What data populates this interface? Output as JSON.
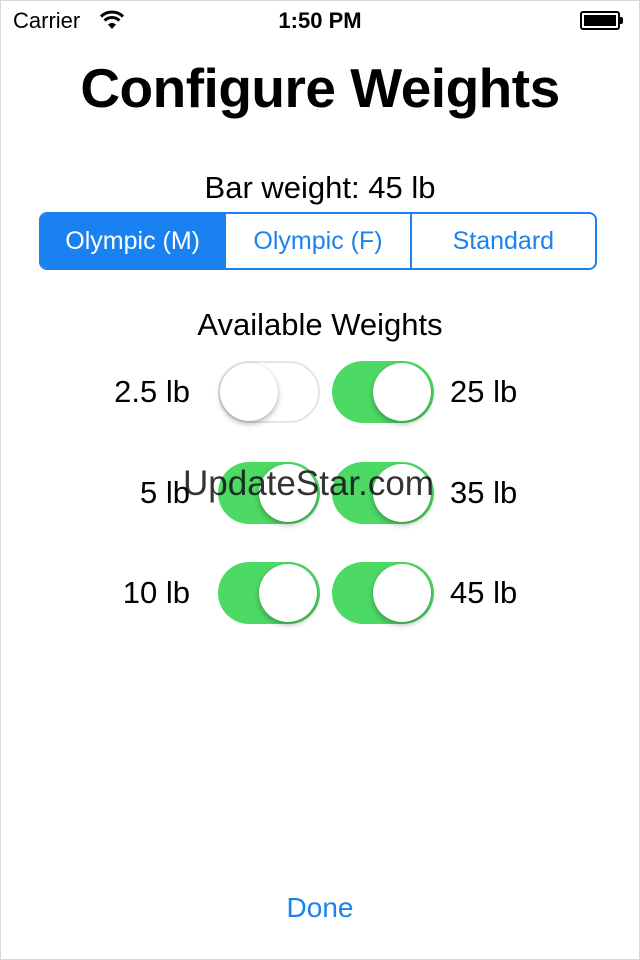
{
  "status_bar": {
    "carrier": "Carrier",
    "time": "1:50 PM",
    "icons": [
      "wifi-icon",
      "battery-icon"
    ]
  },
  "title": "Configure Weights",
  "bar_weight_label": "Bar weight: 45 lb",
  "bar_type": {
    "options": [
      "Olympic (M)",
      "Olympic (F)",
      "Standard"
    ],
    "selected": "Olympic (M)"
  },
  "available_weights": {
    "heading": "Available Weights",
    "left": [
      {
        "label": "2.5 lb",
        "enabled": false
      },
      {
        "label": "5 lb",
        "enabled": true
      },
      {
        "label": "10 lb",
        "enabled": true
      }
    ],
    "right": [
      {
        "label": "25 lb",
        "enabled": true
      },
      {
        "label": "35 lb",
        "enabled": true
      },
      {
        "label": "45 lb",
        "enabled": true
      }
    ]
  },
  "watermark": "UpdateStar.com",
  "done_label": "Done",
  "colors": {
    "accent": "#1a82f0",
    "toggle_on": "#4cd964"
  }
}
